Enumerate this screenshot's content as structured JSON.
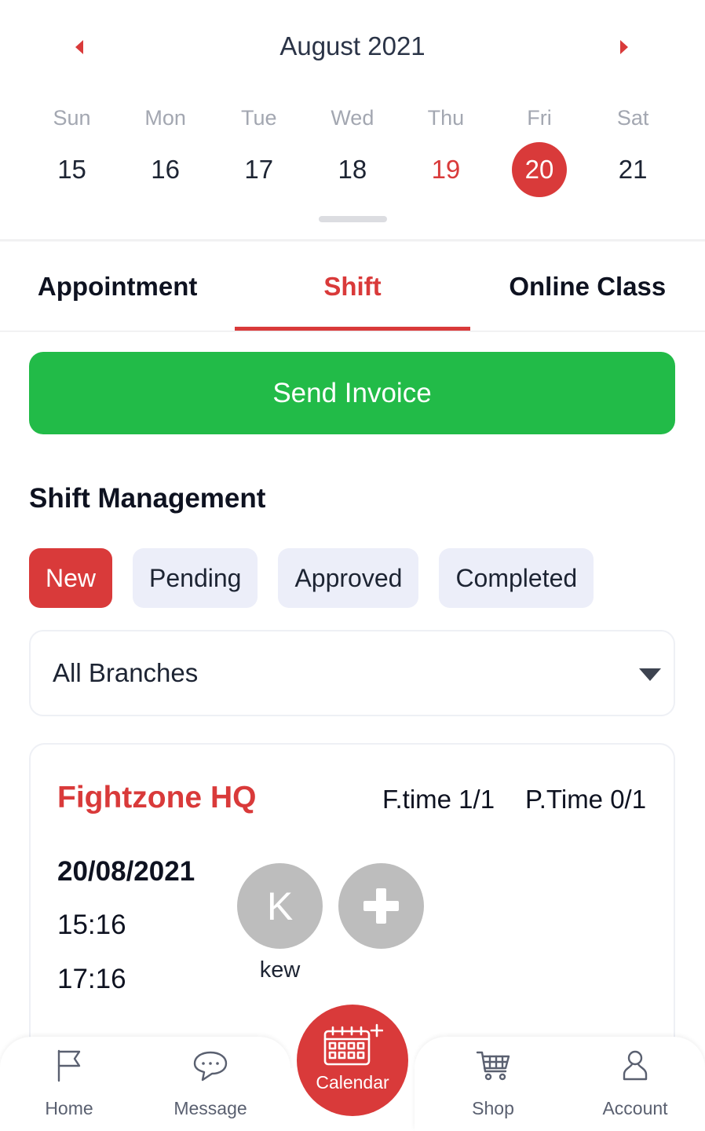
{
  "calendar": {
    "month_label": "August 2021",
    "days": [
      {
        "dow": "Sun",
        "num": "15",
        "state": "normal"
      },
      {
        "dow": "Mon",
        "num": "16",
        "state": "normal"
      },
      {
        "dow": "Tue",
        "num": "17",
        "state": "normal"
      },
      {
        "dow": "Wed",
        "num": "18",
        "state": "normal"
      },
      {
        "dow": "Thu",
        "num": "19",
        "state": "today"
      },
      {
        "dow": "Fri",
        "num": "20",
        "state": "selected"
      },
      {
        "dow": "Sat",
        "num": "21",
        "state": "normal"
      }
    ]
  },
  "tabs": [
    {
      "label": "Appointment",
      "active": false
    },
    {
      "label": "Shift",
      "active": true
    },
    {
      "label": "Online Class",
      "active": false
    }
  ],
  "invoice_button": "Send Invoice",
  "section_title": "Shift Management",
  "filters": [
    {
      "label": "New",
      "active": true
    },
    {
      "label": "Pending",
      "active": false
    },
    {
      "label": "Approved",
      "active": false
    },
    {
      "label": "Completed",
      "active": false
    }
  ],
  "branch_select": {
    "value": "All Branches"
  },
  "shift_card": {
    "branch": "Fightzone HQ",
    "full_time": "F.time 1/1",
    "part_time": "P.Time 0/1",
    "date": "20/08/2021",
    "start_time": "15:16",
    "end_time": "17:16",
    "staff": {
      "initial": "K",
      "name": "kew"
    }
  },
  "bottom_nav": {
    "home": "Home",
    "message": "Message",
    "calendar": "Calendar",
    "shop": "Shop",
    "account": "Account"
  },
  "colors": {
    "accent": "#d93a3a",
    "primary_button": "#22bb48",
    "chip_bg": "#eceef9",
    "avatar_bg": "#bdbdbd"
  }
}
